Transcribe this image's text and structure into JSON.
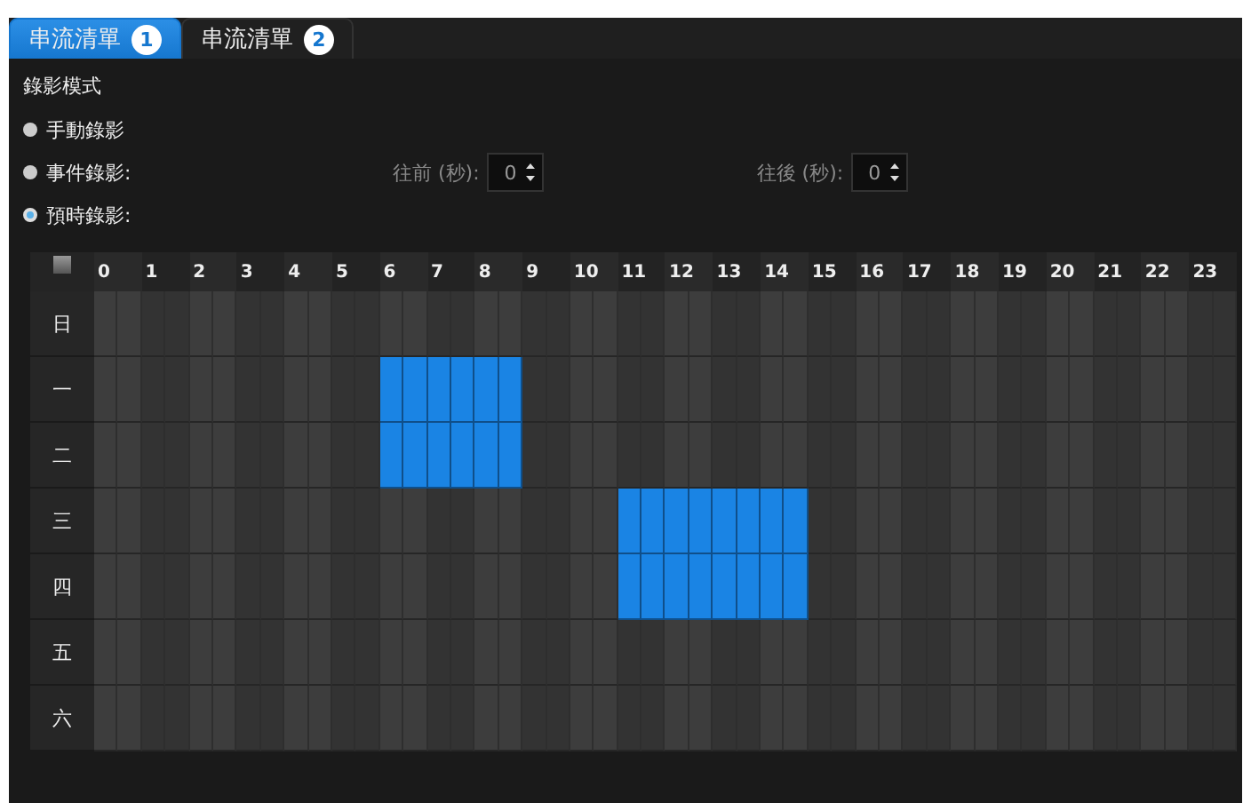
{
  "tabs": [
    {
      "label": "串流清單",
      "badge": "1",
      "selected": true
    },
    {
      "label": "串流清單",
      "badge": "2",
      "selected": false
    }
  ],
  "recording_mode": {
    "title": "錄影模式",
    "options": [
      {
        "label": "手動錄影",
        "selected": false
      },
      {
        "label": "事件錄影:",
        "selected": false
      },
      {
        "label": "預時錄影:",
        "selected": true
      }
    ],
    "spinners": [
      {
        "label": "往前 (秒):",
        "value": "0",
        "disabled": true
      },
      {
        "label": "往後 (秒):",
        "value": "0",
        "disabled": true
      }
    ]
  },
  "schedule": {
    "select_all": {
      "checked": false
    },
    "hours": [
      "0",
      "1",
      "2",
      "3",
      "4",
      "5",
      "6",
      "7",
      "8",
      "9",
      "10",
      "11",
      "12",
      "13",
      "14",
      "15",
      "16",
      "17",
      "18",
      "19",
      "20",
      "21",
      "22",
      "23"
    ],
    "days": [
      {
        "label": "日",
        "slots": [
          false,
          false,
          false,
          false,
          false,
          false,
          false,
          false,
          false,
          false,
          false,
          false,
          false,
          false,
          false,
          false,
          false,
          false,
          false,
          false,
          false,
          false,
          false,
          false,
          false,
          false,
          false,
          false,
          false,
          false,
          false,
          false,
          false,
          false,
          false,
          false,
          false,
          false,
          false,
          false,
          false,
          false,
          false,
          false,
          false,
          false,
          false,
          false
        ]
      },
      {
        "label": "一",
        "slots": [
          false,
          false,
          false,
          false,
          false,
          false,
          false,
          false,
          false,
          false,
          false,
          false,
          true,
          true,
          true,
          true,
          true,
          true,
          false,
          false,
          false,
          false,
          false,
          false,
          false,
          false,
          false,
          false,
          false,
          false,
          false,
          false,
          false,
          false,
          false,
          false,
          false,
          false,
          false,
          false,
          false,
          false,
          false,
          false,
          false,
          false,
          false,
          false
        ]
      },
      {
        "label": "二",
        "slots": [
          false,
          false,
          false,
          false,
          false,
          false,
          false,
          false,
          false,
          false,
          false,
          false,
          true,
          true,
          true,
          true,
          true,
          true,
          false,
          false,
          false,
          false,
          false,
          false,
          false,
          false,
          false,
          false,
          false,
          false,
          false,
          false,
          false,
          false,
          false,
          false,
          false,
          false,
          false,
          false,
          false,
          false,
          false,
          false,
          false,
          false,
          false,
          false
        ]
      },
      {
        "label": "三",
        "slots": [
          false,
          false,
          false,
          false,
          false,
          false,
          false,
          false,
          false,
          false,
          false,
          false,
          false,
          false,
          false,
          false,
          false,
          false,
          false,
          false,
          false,
          false,
          true,
          true,
          true,
          true,
          true,
          true,
          true,
          true,
          false,
          false,
          false,
          false,
          false,
          false,
          false,
          false,
          false,
          false,
          false,
          false,
          false,
          false,
          false,
          false,
          false,
          false
        ]
      },
      {
        "label": "四",
        "slots": [
          false,
          false,
          false,
          false,
          false,
          false,
          false,
          false,
          false,
          false,
          false,
          false,
          false,
          false,
          false,
          false,
          false,
          false,
          false,
          false,
          false,
          false,
          true,
          true,
          true,
          true,
          true,
          true,
          true,
          true,
          false,
          false,
          false,
          false,
          false,
          false,
          false,
          false,
          false,
          false,
          false,
          false,
          false,
          false,
          false,
          false,
          false,
          false
        ]
      },
      {
        "label": "五",
        "slots": [
          false,
          false,
          false,
          false,
          false,
          false,
          false,
          false,
          false,
          false,
          false,
          false,
          false,
          false,
          false,
          false,
          false,
          false,
          false,
          false,
          false,
          false,
          false,
          false,
          false,
          false,
          false,
          false,
          false,
          false,
          false,
          false,
          false,
          false,
          false,
          false,
          false,
          false,
          false,
          false,
          false,
          false,
          false,
          false,
          false,
          false,
          false,
          false
        ]
      },
      {
        "label": "六",
        "slots": [
          false,
          false,
          false,
          false,
          false,
          false,
          false,
          false,
          false,
          false,
          false,
          false,
          false,
          false,
          false,
          false,
          false,
          false,
          false,
          false,
          false,
          false,
          false,
          false,
          false,
          false,
          false,
          false,
          false,
          false,
          false,
          false,
          false,
          false,
          false,
          false,
          false,
          false,
          false,
          false,
          false,
          false,
          false,
          false,
          false,
          false,
          false,
          false
        ]
      }
    ]
  }
}
